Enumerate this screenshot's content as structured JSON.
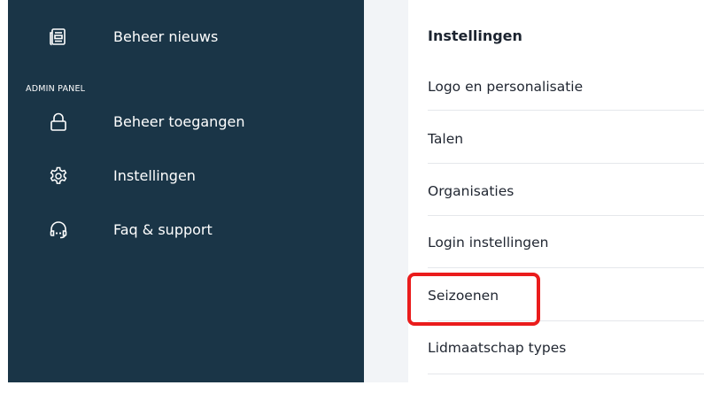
{
  "sidebar": {
    "section_label": "ADMIN PANEL",
    "items": [
      {
        "label": "Beheer nieuws",
        "icon": "newspaper-icon"
      },
      {
        "label": "Beheer toegangen",
        "icon": "lock-icon"
      },
      {
        "label": "Instellingen",
        "icon": "gear-icon"
      },
      {
        "label": "Faq & support",
        "icon": "headset-icon"
      }
    ]
  },
  "settings_panel": {
    "title": "Instellingen",
    "items": [
      {
        "label": "Logo en personalisatie"
      },
      {
        "label": "Talen"
      },
      {
        "label": "Organisaties"
      },
      {
        "label": "Login instellingen"
      },
      {
        "label": "Seizoenen",
        "highlighted": true
      },
      {
        "label": "Lidmaatschap types"
      }
    ]
  },
  "colors": {
    "sidebar_bg": "#1a3547",
    "highlight_border": "#ea1c1c",
    "panel_text": "#1f2530"
  }
}
